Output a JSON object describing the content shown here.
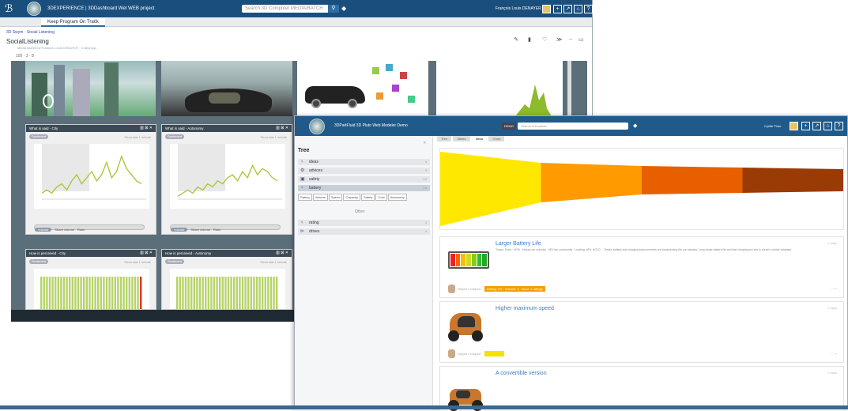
{
  "app": {
    "title": "3DEXPERIENCE | 3DDashboard Wet WEB project",
    "search_placeholder": "Search 3D Computer MEDIA/BATCH",
    "user": "François Louis DENAYER",
    "tab": "Keep Program On Track",
    "tab_add": "+"
  },
  "doc": {
    "crumbs": "3D Swym · Social Listening",
    "title": "SocialListening",
    "subtitle": "Media shared by François Louis DENAYER · 3 days ago",
    "mini_actions": "100 · 3 · 8"
  },
  "cards": [
    {
      "title": "What is said - City",
      "pill": "Sentiment",
      "chip": "Show last 1 minute"
    },
    {
      "title": "What is said - Autonomy",
      "pill": "Sentiment",
      "chip": "Show last 1 minute"
    },
    {
      "title": "How is perceived - City",
      "pill": "Sentiment",
      "chip": "Show last 1 minute"
    },
    {
      "title": "How is perceived - Autonomy",
      "pill": "Sentiment",
      "chip": "Show last 1 minute"
    }
  ],
  "controls": [
    "Volume",
    "Share volume",
    "Ratio"
  ],
  "footer": "Powered by",
  "front": {
    "title": "3DPartFluid 3D Pluto Web Modeler Demo",
    "search_badge": "DEMO",
    "search_placeholder": "Search in Exalead",
    "user": "Cyrille Pluto",
    "tabs": [
      "Tree",
      "Tables",
      "Ideas",
      "Chart"
    ],
    "tree_title": "Tree",
    "rows": [
      {
        "label": "ideas",
        "count": "4"
      },
      {
        "label": "advices",
        "count": "3"
      },
      {
        "label": "safety",
        "count": "14"
      },
      {
        "label": "battery",
        "count": "14"
      },
      {
        "label": "rating",
        "count": "4"
      },
      {
        "label": "drives",
        "count": "4"
      }
    ],
    "chips": [
      "Rating",
      "Volume",
      "Speed",
      "Capacity",
      "Safety",
      "Cost",
      "Autonomy"
    ],
    "chip_hover": "Other",
    "posts": [
      {
        "title": "Larger Battery Life",
        "badge": "Rating: 3.5 · Volume: 3 · Buzz: 2 ratings",
        "author": "Wayne Lindquist",
        "time": "2 days",
        "body": "Topics: Tesla · #GM · #future car industry · #EV fan community · Leading: #EV, #CEO ... Tesla's battery and charging improvements are transforming the car industry. Long-range battery life and fast charging are key to electric vehicle adoption."
      },
      {
        "title": "Higher maximum speed",
        "badge": "Rating: 3.0",
        "author": "Wayne Lindquist",
        "time": "2 days"
      },
      {
        "title": "A convertible version",
        "time": "2 days"
      }
    ]
  },
  "chart_data": {
    "type": "area",
    "title": "",
    "series": [
      {
        "values": [
          2,
          3,
          2,
          4,
          5,
          3,
          6,
          8,
          5,
          7,
          9,
          6,
          8,
          12,
          7,
          9,
          14,
          10,
          8,
          6,
          5
        ]
      },
      {
        "values": [
          1,
          2,
          3,
          2,
          4,
          3,
          5,
          4,
          6,
          5,
          7,
          8,
          6,
          9,
          7,
          11,
          8,
          10,
          9,
          7,
          6
        ]
      }
    ]
  },
  "colors": {
    "brand": "#1a4f7d",
    "bar": "#b6d36a",
    "funnel": [
      "#ffe800",
      "#ff9a00",
      "#e85f00",
      "#9a3a05"
    ]
  }
}
